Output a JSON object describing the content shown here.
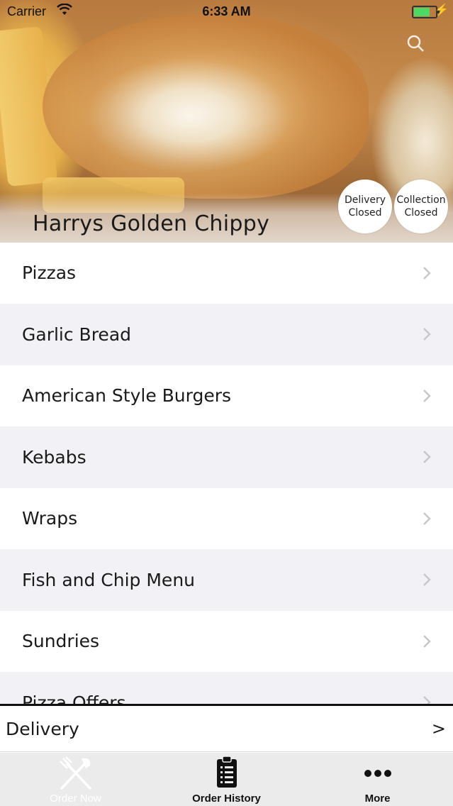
{
  "status_bar": {
    "carrier": "Carrier",
    "time": "6:33 AM"
  },
  "header": {
    "restaurant_name": "Harrys Golden Chippy",
    "delivery_status": {
      "line1": "Delivery",
      "line2": "Closed"
    },
    "collection_status": {
      "line1": "Collection",
      "line2": "Closed"
    },
    "search_icon": "search-icon"
  },
  "menu": {
    "items": [
      {
        "label": "Pizzas"
      },
      {
        "label": "Garlic Bread"
      },
      {
        "label": "American Style Burgers"
      },
      {
        "label": "Kebabs"
      },
      {
        "label": "Wraps"
      },
      {
        "label": "Fish and Chip Menu"
      },
      {
        "label": "Sundries"
      },
      {
        "label": "Pizza Offers"
      }
    ]
  },
  "order_mode": {
    "label": "Delivery",
    "arrow": ">"
  },
  "tabbar": {
    "tabs": [
      {
        "label": "Order Now",
        "icon": "fork-knife-icon",
        "active": true
      },
      {
        "label": "Order History",
        "icon": "clipboard-list-icon",
        "active": false
      },
      {
        "label": "More",
        "icon": "ellipsis-icon",
        "active": false
      }
    ]
  },
  "colors": {
    "row_alt": "#f2f2f6",
    "tabbar_bg": "#ebebeb",
    "battery_green": "#4cd964"
  }
}
